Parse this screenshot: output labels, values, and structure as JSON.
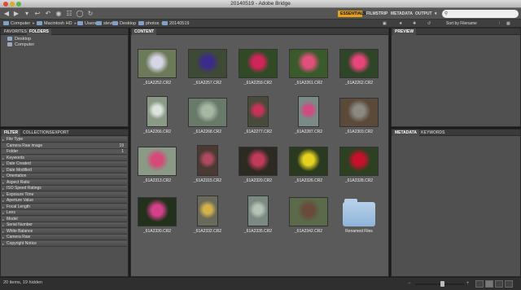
{
  "window": {
    "title": "20140519 - Adobe Bridge"
  },
  "toolbar": {
    "icons": [
      "back-arrow-icon",
      "forward-arrow-icon",
      "history-icon",
      "reveal-folder-icon",
      "boomerang-icon",
      "camera-download-icon",
      "refine-icon",
      "open-in-camera-raw-icon",
      "rotate-icon"
    ],
    "workspaces": [
      "ESSENTIALS",
      "FILMSTRIP",
      "METADATA",
      "OUTPUT"
    ],
    "active_workspace": "ESSENTIALS",
    "search_placeholder": ""
  },
  "path": {
    "crumbs": [
      "Computer",
      "Macintosh HD",
      "Users",
      "steve",
      "Desktop",
      "photos",
      "20140519"
    ],
    "sort_label": "Sort by Filename"
  },
  "left_panel": {
    "tabs": [
      "FAVORITES",
      "FOLDERS"
    ],
    "active_tab": "FOLDERS",
    "items": [
      "Desktop",
      "Computer"
    ]
  },
  "filter_panel": {
    "tabs": [
      "FILTER",
      "COLLECTIONS",
      "EXPORT"
    ],
    "active_tab": "FILTER",
    "rows": [
      {
        "label": "File Type",
        "count": "",
        "sub": false
      },
      {
        "label": "Camera Raw image",
        "count": "19",
        "sub": true
      },
      {
        "label": "Folder",
        "count": "1",
        "sub": true
      },
      {
        "label": "Keywords",
        "count": "",
        "sub": false
      },
      {
        "label": "Date Created",
        "count": "",
        "sub": false
      },
      {
        "label": "Date Modified",
        "count": "",
        "sub": false
      },
      {
        "label": "Orientation",
        "count": "",
        "sub": false
      },
      {
        "label": "Aspect Ratio",
        "count": "",
        "sub": false
      },
      {
        "label": "ISO Speed Ratings",
        "count": "",
        "sub": false
      },
      {
        "label": "Exposure Time",
        "count": "",
        "sub": false
      },
      {
        "label": "Aperture Value",
        "count": "",
        "sub": false
      },
      {
        "label": "Focal Length",
        "count": "",
        "sub": false
      },
      {
        "label": "Lens",
        "count": "",
        "sub": false
      },
      {
        "label": "Model",
        "count": "",
        "sub": false
      },
      {
        "label": "Serial Number",
        "count": "",
        "sub": false
      },
      {
        "label": "White Balance",
        "count": "",
        "sub": false
      },
      {
        "label": "Camera Raw",
        "count": "",
        "sub": false
      },
      {
        "label": "Copyright Notice",
        "count": "",
        "sub": false
      }
    ]
  },
  "content": {
    "tab": "CONTENT",
    "items": [
      {
        "name": "_61A2252.CR2",
        "kind": "photo",
        "bg": "#6d7a5a",
        "accent": "#d6d6e6",
        "orient": "land"
      },
      {
        "name": "_61A2257.CR2",
        "kind": "photo",
        "bg": "#3e4a35",
        "accent": "#3b2b8a",
        "orient": "land"
      },
      {
        "name": "_61A2259.CR2",
        "kind": "photo",
        "bg": "#2f4a25",
        "accent": "#d0245a",
        "orient": "land"
      },
      {
        "name": "_61A2261.CR2",
        "kind": "photo",
        "bg": "#3b5a2c",
        "accent": "#e0507a",
        "orient": "land"
      },
      {
        "name": "_61A2262.CR2",
        "kind": "photo",
        "bg": "#2f4527",
        "accent": "#e8457a",
        "orient": "land"
      },
      {
        "name": "_61A2266.CR2",
        "kind": "photo",
        "bg": "#8a9a86",
        "accent": "#dde3de",
        "orient": "port"
      },
      {
        "name": "_61A2268.CR2",
        "kind": "photo",
        "bg": "#6a7a6a",
        "accent": "#a6b8a4",
        "orient": "land"
      },
      {
        "name": "_61A2277.CR2",
        "kind": "photo",
        "bg": "#4a4a3a",
        "accent": "#c8325a",
        "orient": "port"
      },
      {
        "name": "_61A2287.CR2",
        "kind": "photo",
        "bg": "#7a8a86",
        "accent": "#d24a82",
        "orient": "port"
      },
      {
        "name": "_61A2303.CR2",
        "kind": "photo",
        "bg": "#5b4a3a",
        "accent": "#8a8a82",
        "orient": "land"
      },
      {
        "name": "_61A2313.CR2",
        "kind": "photo",
        "bg": "#8a9a86",
        "accent": "#d64a7a",
        "orient": "land"
      },
      {
        "name": "_61A2315.CR2",
        "kind": "photo",
        "bg": "#4a3a32",
        "accent": "#b04a62",
        "orient": "port"
      },
      {
        "name": "_61A2320.CR2",
        "kind": "photo",
        "bg": "#2d2a24",
        "accent": "#c23a5a",
        "orient": "land"
      },
      {
        "name": "_61A2326.CR2",
        "kind": "photo",
        "bg": "#2a3a1e",
        "accent": "#e6d21e",
        "orient": "land"
      },
      {
        "name": "_61A2328.CR2",
        "kind": "photo",
        "bg": "#2e4022",
        "accent": "#c8102a",
        "orient": "land"
      },
      {
        "name": "_61A2330.CR2",
        "kind": "photo",
        "bg": "#22301c",
        "accent": "#d4408a",
        "orient": "land"
      },
      {
        "name": "_61A2332.CR2",
        "kind": "photo",
        "bg": "#6a6a5a",
        "accent": "#d4b24a",
        "orient": "port"
      },
      {
        "name": "_61A2335.CR2",
        "kind": "photo",
        "bg": "#7a8a82",
        "accent": "#b6c4b6",
        "orient": "port"
      },
      {
        "name": "_61A2342.CR2",
        "kind": "photo",
        "bg": "#5a6a4a",
        "accent": "#6a4a3a",
        "orient": "land"
      },
      {
        "name": "Renamed Files",
        "kind": "folder",
        "bg": "#8fb4d8",
        "accent": "#b6d0ea",
        "orient": "land"
      }
    ]
  },
  "right_panel": {
    "preview_tab": "PREVIEW",
    "meta_tabs": [
      "METADATA",
      "KEYWORDS"
    ]
  },
  "status": {
    "text": "20 items, 19 hidden"
  },
  "zoom": {
    "level": 0.55
  }
}
